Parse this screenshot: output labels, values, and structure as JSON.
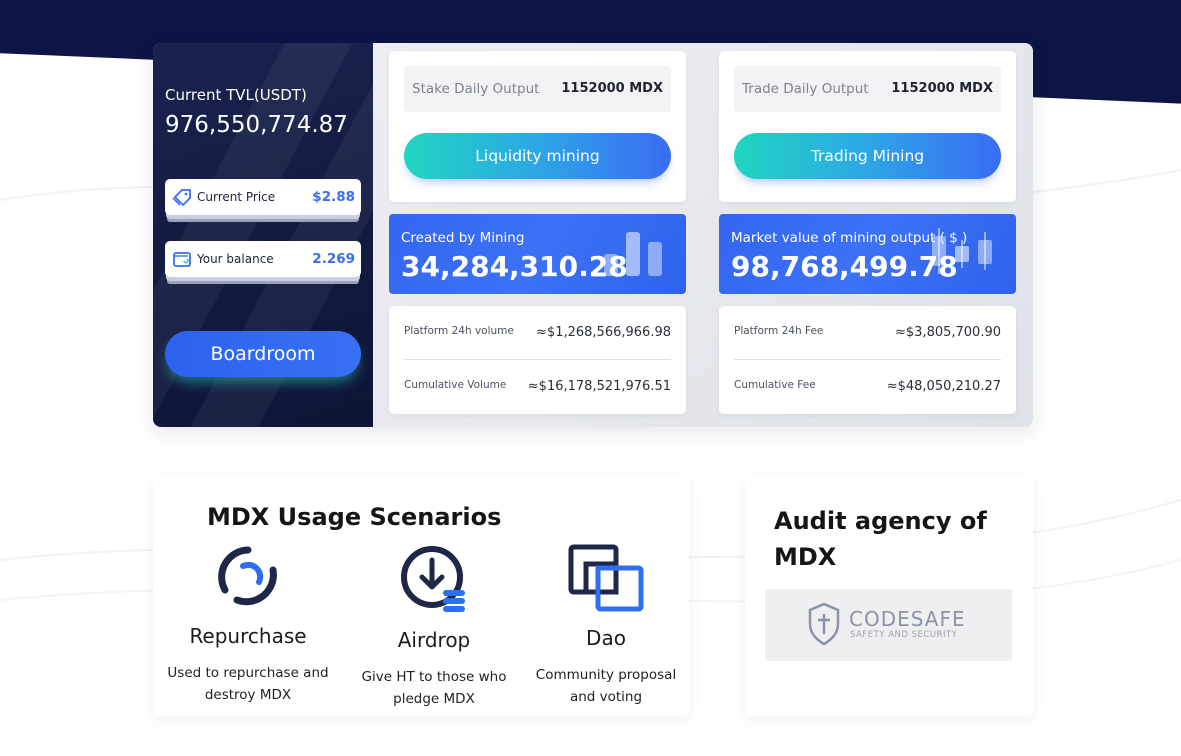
{
  "tvl": {
    "label": "Current TVL(USDT)",
    "value": "976,550,774.87"
  },
  "price": {
    "label": "Current Price",
    "value": "$2.88"
  },
  "balance": {
    "label": "Your balance",
    "value": "2.269"
  },
  "boardroom": {
    "label": "Boardroom"
  },
  "stake": {
    "label": "Stake Daily Output",
    "value": "1152000 MDX",
    "button": "Liquidity mining"
  },
  "trade": {
    "label": "Trade Daily Output",
    "value": "1152000 MDX",
    "button": "Trading Mining"
  },
  "created": {
    "label": "Created by Mining",
    "value": "34,284,310.28"
  },
  "market": {
    "label": "Market value of mining output ( $ )",
    "value": "98,768,499.78"
  },
  "volume": {
    "platform_label": "Platform 24h volume",
    "platform_value": "≈$1,268,566,966.98",
    "cumulative_label": "Cumulative Volume",
    "cumulative_value": "≈$16,178,521,976.51"
  },
  "fee": {
    "platform_label": "Platform 24h Fee",
    "platform_value": "≈$3,805,700.90",
    "cumulative_label": "Cumulative Fee",
    "cumulative_value": "≈$48,050,210.27"
  },
  "usage": {
    "title": "MDX Usage Scenarios",
    "items": [
      {
        "icon": "repurchase-icon",
        "title": "Repurchase",
        "desc": "Used to repurchase and destroy MDX"
      },
      {
        "icon": "airdrop-icon",
        "title": "Airdrop",
        "desc": "Give HT to those who pledge MDX"
      },
      {
        "icon": "dao-icon",
        "title": "Dao",
        "desc": "Community proposal and voting"
      }
    ]
  },
  "audit": {
    "title": "Audit agency of MDX",
    "brand": "CODESAFE",
    "tagline": "SAFETY AND SECURITY"
  },
  "colors": {
    "navy": "#0d1446",
    "accent_blue": "#3a6cf4",
    "teal": "#1fd6c0"
  }
}
